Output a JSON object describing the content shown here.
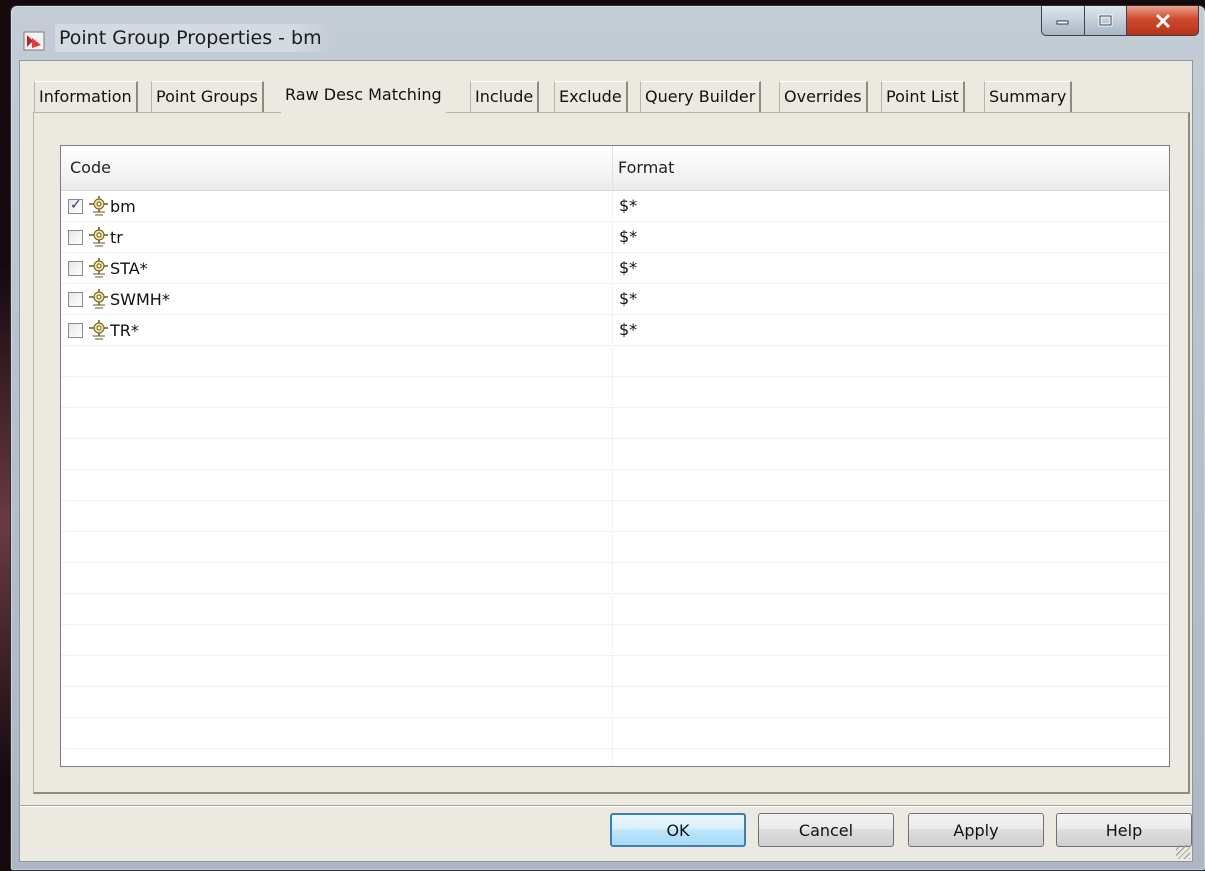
{
  "window": {
    "title": "Point Group Properties - bm"
  },
  "tabs": [
    {
      "label": "Information",
      "active": false
    },
    {
      "label": "Point Groups",
      "active": false
    },
    {
      "label": "Raw Desc Matching",
      "active": true
    },
    {
      "label": "Include",
      "active": false
    },
    {
      "label": "Exclude",
      "active": false
    },
    {
      "label": "Query Builder",
      "active": false
    },
    {
      "label": "Overrides",
      "active": false
    },
    {
      "label": "Point List",
      "active": false
    },
    {
      "label": "Summary",
      "active": false
    }
  ],
  "list": {
    "columns": {
      "code": "Code",
      "format": "Format"
    },
    "rows": [
      {
        "code": "bm",
        "format": "$*",
        "checked": true,
        "icon": "raw-description-key-icon"
      },
      {
        "code": "tr",
        "format": "$*",
        "checked": false,
        "icon": "raw-description-key-icon"
      },
      {
        "code": "STA*",
        "format": "$*",
        "checked": false,
        "icon": "raw-description-key-icon"
      },
      {
        "code": "SWMH*",
        "format": "$*",
        "checked": false,
        "icon": "raw-description-key-icon"
      },
      {
        "code": "TR*",
        "format": "$*",
        "checked": false,
        "icon": "raw-description-key-icon"
      }
    ]
  },
  "buttons": {
    "ok": "OK",
    "cancel": "Cancel",
    "apply": "Apply",
    "help": "Help"
  },
  "colors": {
    "dialog_bg": "#ece9e1",
    "close_button": "#cf4a2d",
    "default_button_border": "#3c7fb1"
  }
}
